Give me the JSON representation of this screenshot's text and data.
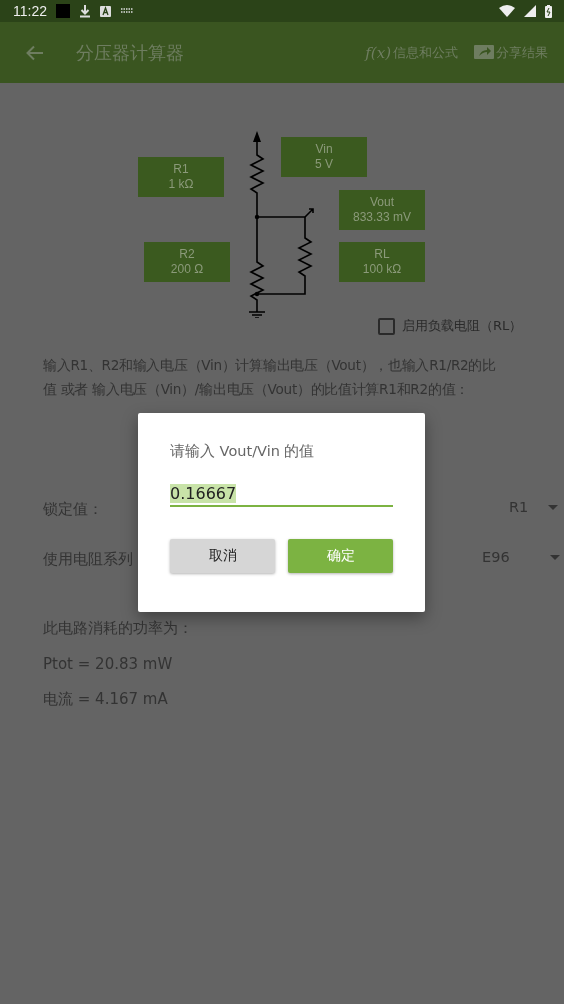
{
  "status_bar": {
    "time": "11:22"
  },
  "app_bar": {
    "title": "分压器计算器",
    "actions": [
      {
        "kind": "formula",
        "icon_text": "f(x)",
        "label": "信息和公式"
      },
      {
        "kind": "share",
        "label": "分享结果"
      }
    ]
  },
  "circuit": {
    "boxes": [
      {
        "label": "R1",
        "value": "1 kΩ"
      },
      {
        "label": "Vin",
        "value": "5 V"
      },
      {
        "label": "Vout",
        "value": "833.33 mV"
      },
      {
        "label": "R2",
        "value": "200 Ω"
      },
      {
        "label": "RL",
        "value": "100 kΩ"
      }
    ]
  },
  "load_checkbox": {
    "label": "启用负载电阻（RL）",
    "checked": false
  },
  "description": "输入R1、R2和输入电压（Vin）计算输出电压（Vout），也输入R1/R2的比值 或者 输入电压（Vin）/输出电压（Vout）的比值计算R1和R2的值：",
  "lock": {
    "label": "锁定值：",
    "value": "R1"
  },
  "series": {
    "label": "使用电阻系列",
    "value": "E96"
  },
  "power": {
    "heading": "此电路消耗的功率为：",
    "ptot": "Ptot = 20.83 mW",
    "current": "电流 = 4.167 mA"
  },
  "dialog": {
    "title": "请输入 Vout/Vin 的值",
    "value": "0.16667",
    "text_selected": true,
    "buttons": [
      {
        "kind": "secondary",
        "label": "取消"
      },
      {
        "kind": "primary",
        "label": "确定"
      }
    ]
  }
}
